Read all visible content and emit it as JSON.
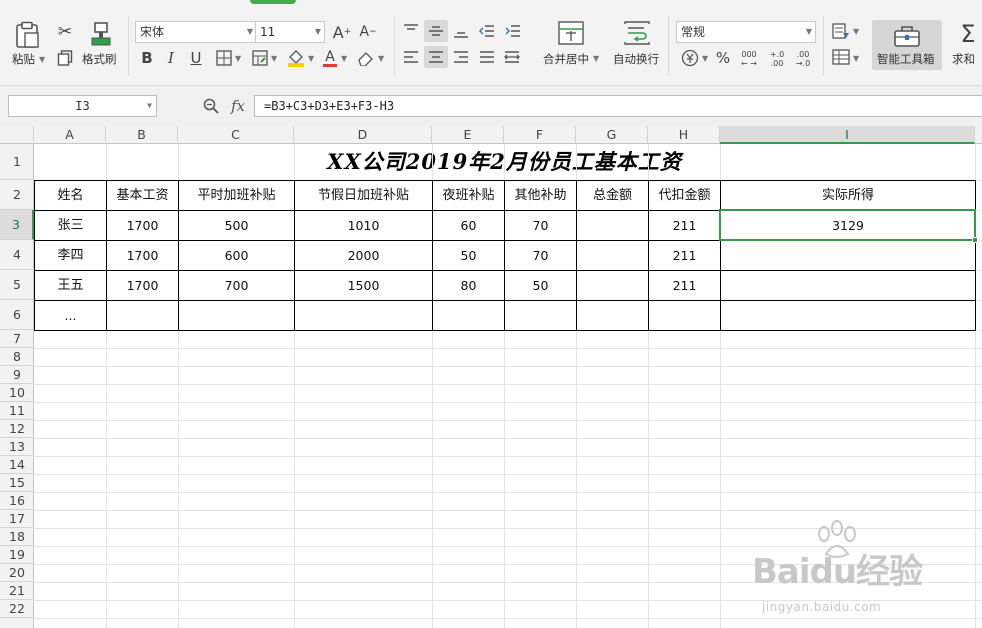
{
  "ribbon": {
    "paste": "粘贴",
    "format_painter": "格式刷",
    "font_name": "宋体",
    "font_size": "11",
    "bold": "B",
    "italic": "I",
    "underline": "U",
    "merge_center": "合并居中",
    "wrap_text": "自动换行",
    "number_format": "常规",
    "percent": "%",
    "smart_toolbox": "智能工具箱",
    "sum": "求和"
  },
  "formula_bar": {
    "name_box": "I3",
    "fx": "fx",
    "formula": "=B3+C3+D3+E3+F3-H3"
  },
  "columns": [
    "A",
    "B",
    "C",
    "D",
    "E",
    "F",
    "G",
    "H",
    "I"
  ],
  "selected_column": "I",
  "rows": [
    "1",
    "2",
    "3",
    "4",
    "5",
    "6",
    "7",
    "8",
    "9",
    "10",
    "11",
    "12",
    "13",
    "14",
    "15",
    "16",
    "17",
    "18",
    "19",
    "20",
    "21",
    "22"
  ],
  "selected_row": "3",
  "sheet": {
    "title": "XX公司2019年2月份员工基本工资",
    "headers": [
      "姓名",
      "基本工资",
      "平时加班补贴",
      "节假日加班补贴",
      "夜班补贴",
      "其他补助",
      "总金额",
      "代扣金额",
      "实际所得"
    ],
    "data": [
      [
        "张三",
        "1700",
        "500",
        "1010",
        "60",
        "70",
        "",
        "211",
        "3129"
      ],
      [
        "李四",
        "1700",
        "600",
        "2000",
        "50",
        "70",
        "",
        "211",
        ""
      ],
      [
        "王五",
        "1700",
        "700",
        "1500",
        "80",
        "50",
        "",
        "211",
        ""
      ],
      [
        "...",
        "",
        "",
        "",
        "",
        "",
        "",
        "",
        ""
      ]
    ]
  },
  "watermark": {
    "logo": "Baidu经验",
    "url": "jingyan.baidu.com"
  }
}
